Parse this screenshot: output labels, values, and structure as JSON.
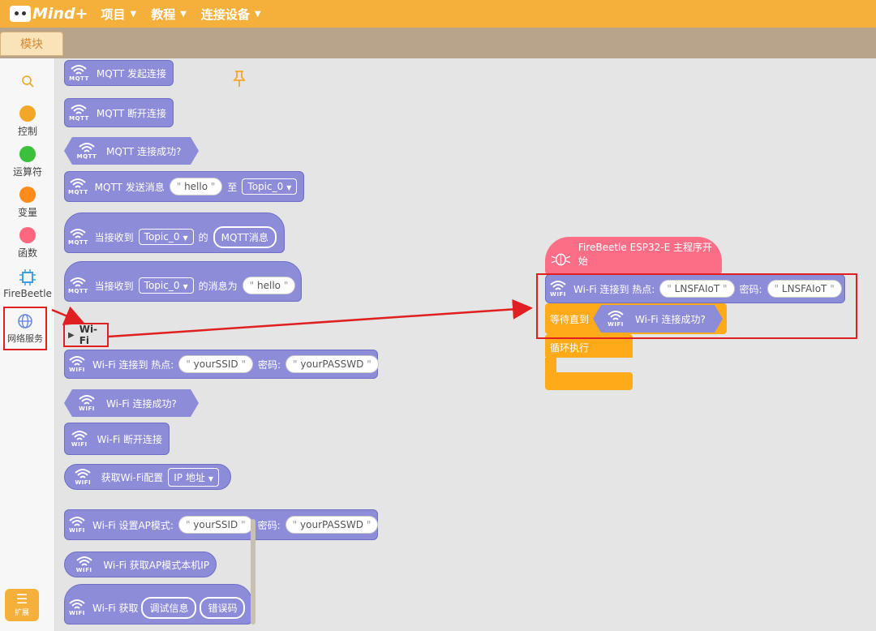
{
  "topbar": {
    "logo_text": "Mind+",
    "menu": [
      {
        "label": "项目"
      },
      {
        "label": "教程"
      },
      {
        "label": "连接设备"
      }
    ]
  },
  "tabs": {
    "blocks": "模块"
  },
  "categories": [
    {
      "label": "控制",
      "color": "#f4a629"
    },
    {
      "label": "运算符",
      "color": "#3ac03a"
    },
    {
      "label": "变量",
      "color": "#ff8c1a"
    },
    {
      "label": "函数",
      "color": "#ff6680"
    },
    {
      "label": "FireBeetle",
      "color": "#3aa0e0"
    },
    {
      "label": "网络服务",
      "color": "#6a8ad8"
    }
  ],
  "extend_label": "扩展",
  "flyout": {
    "mqtt_connect": "MQTT 发起连接",
    "mqtt_disconnect": "MQTT 断开连接",
    "mqtt_connected": "MQTT 连接成功?",
    "mqtt_send": {
      "text": "MQTT 发送消息",
      "msg": "hello",
      "to": "至",
      "topic": "Topic_0"
    },
    "mqtt_on_receive": {
      "text": "当接收到",
      "topic": "Topic_0",
      "of": "的",
      "msg": "MQTT消息"
    },
    "mqtt_on_receive_is": {
      "text": "当接收到",
      "topic": "Topic_0",
      "suffix": "的消息为",
      "msg": "hello"
    },
    "wifi_section": "Wi-Fi",
    "wifi_connect": {
      "text": "Wi-Fi 连接到 热点:",
      "ssid": "yourSSID",
      "pwd_label": "密码:",
      "pwd": "yourPASSWD"
    },
    "wifi_connected": "Wi-Fi 连接成功?",
    "wifi_disconnect": "Wi-Fi 断开连接",
    "wifi_get_config": {
      "text": "获取Wi-Fi配置",
      "option": "IP 地址"
    },
    "wifi_ap_mode": {
      "text": "Wi-Fi 设置AP模式:",
      "ssid": "yourSSID",
      "pwd_label": "密码:",
      "pwd": "yourPASSWD"
    },
    "wifi_ap_ip": "Wi-Fi 获取AP模式本机IP",
    "wifi_get": {
      "text": "Wi-Fi 获取",
      "debug": "调试信息",
      "error": "错误码"
    },
    "mqtt_tag": "MQTT",
    "wifi_tag": "WIFI"
  },
  "program": {
    "hat": "FireBeetle ESP32-E 主程序开始",
    "wifi_connect": {
      "text": "Wi-Fi 连接到 热点:",
      "ssid": "LNSFAIoT",
      "pwd_label": "密码:",
      "pwd": "LNSFAIoT"
    },
    "wait_until": "等待直到",
    "wifi_connected": "Wi-Fi 连接成功?",
    "loop": "循环执行"
  },
  "colors": {
    "topbar": "#f4b03a",
    "block_network": "#8c8cd9",
    "hat_red": "#fc6d86",
    "control_orange": "#ffab19",
    "annotation_red": "#e02020"
  }
}
